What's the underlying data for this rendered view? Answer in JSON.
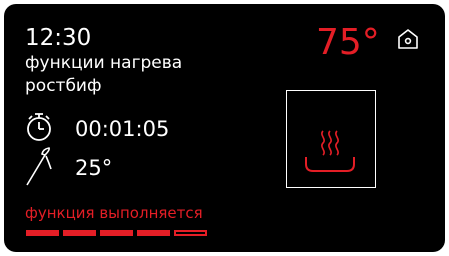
{
  "colors": {
    "accent": "#e41e26",
    "text": "#ffffff",
    "background": "#000000"
  },
  "header": {
    "time": "12:30",
    "temperature": "75°",
    "home_icon": "home-icon"
  },
  "program": {
    "function_title": "функции нагрева",
    "function_name": "ростбиф",
    "mode_icon": "bottom-heat-icon"
  },
  "timer": {
    "icon": "stopwatch-icon",
    "value": "00:01:05"
  },
  "probe": {
    "icon": "meat-probe-icon",
    "value": "25°"
  },
  "status": {
    "text": "функция выполняется",
    "progress": {
      "filled": 4,
      "total": 5
    }
  }
}
